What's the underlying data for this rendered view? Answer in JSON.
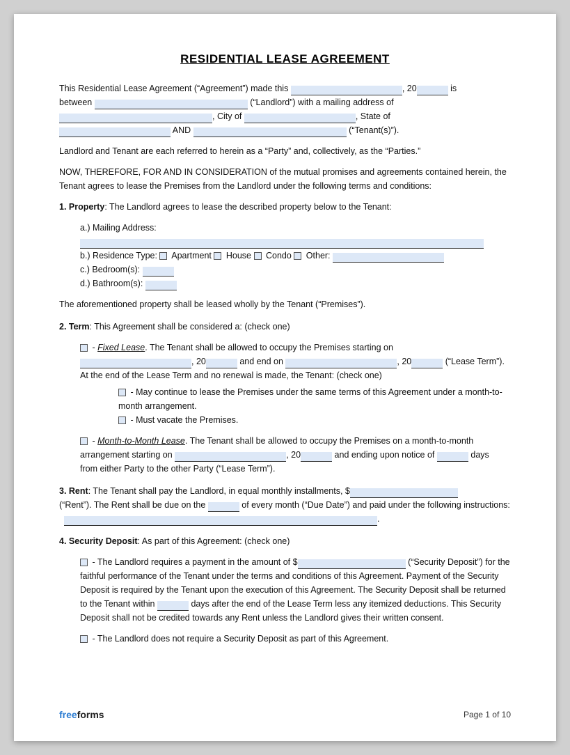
{
  "title": "RESIDENTIAL LEASE AGREEMENT",
  "intro": {
    "line1": "This Residential Lease Agreement (“Agreement”) made this",
    "year_prefix": ", 20",
    "year_suffix": " is",
    "line2": "between",
    "landlord_suffix": "(“Landlord”) with a mailing address of",
    "city_prefix": ", City of",
    "state_suffix": ", State of",
    "and_label": "AND",
    "tenant_suffix": "(“Tenant(s)”)."
  },
  "parties_text": "Landlord and Tenant are each referred to herein as a “Party” and, collectively, as the “Parties.”",
  "now_therefore": "NOW, THEREFORE, FOR AND IN CONSIDERATION of the mutual promises and agreements contained herein, the Tenant agrees to lease the Premises from the Landlord under the following terms and conditions:",
  "section1": {
    "heading": "1. Property",
    "text": ": The Landlord agrees to lease the described property below to the Tenant:",
    "items": {
      "a_label": "a.)  Mailing Address:",
      "b_label": "b.)  Residence Type:",
      "apartment": "Apartment",
      "house": "House",
      "condo": "Condo",
      "other": "Other:",
      "c_label": "c.)  Bedroom(s):",
      "d_label": "d.)  Bathroom(s):"
    },
    "footer_text": "The aforementioned property shall be leased wholly by the Tenant (“Premises”)."
  },
  "section2": {
    "heading": "2. Term",
    "text": ": This Agreement shall be considered a: (check one)",
    "fixed_lease_label": "- ",
    "fixed_lease_italic": "Fixed Lease",
    "fixed_lease_text": ". The Tenant shall be allowed to occupy the Premises starting on",
    "fixed_lease_line2": ", 20",
    "fixed_lease_and": " and end on",
    "fixed_lease_end": ", 20",
    "fixed_lease_end_suffix": " (“Lease Term”). At the end of the Lease Term and no renewal is made, the Tenant: (check one)",
    "fixed_option1": "- May continue to lease the Premises under the same terms of this Agreement under a month-to-month arrangement.",
    "fixed_option2": "- Must vacate the Premises.",
    "month_label": "- ",
    "month_italic": "Month-to-Month Lease",
    "month_text": ". The Tenant shall be allowed to occupy the Premises on a month-to-month arrangement starting on",
    "month_line2": ", 20",
    "month_ending": " and ending upon notice of",
    "month_days": "days",
    "month_suffix": "from either Party to the other Party (“Lease Term”)."
  },
  "section3": {
    "heading": "3. Rent",
    "text": ": The Tenant shall pay the Landlord, in equal monthly installments, $",
    "rent_suffix": "(“Rent”). The Rent shall be due on the",
    "due_suffix": "of every month (“Due Date”) and paid under the following instructions:",
    "instructions_suffix": "."
  },
  "section4": {
    "heading": "4. Security Deposit",
    "text": ": As part of this Agreement: (check one)",
    "option1_text": "- The Landlord requires a payment in the amount of $",
    "option1_suffix": "(“Security Deposit”) for the faithful performance of the Tenant under the terms and conditions of this Agreement. Payment of the Security Deposit is required by the Tenant upon the execution of this Agreement. The Security Deposit shall be returned to the Tenant within",
    "days_label": "days",
    "option1_cont": "after the end of the Lease Term less any itemized deductions. This Security Deposit shall not be credited towards any Rent unless the Landlord gives their written consent.",
    "option2_text": "- The Landlord does not require a Security Deposit as part of this Agreement."
  },
  "footer": {
    "brand_free": "free",
    "brand_forms": "forms",
    "page": "Page 1 of 10"
  }
}
